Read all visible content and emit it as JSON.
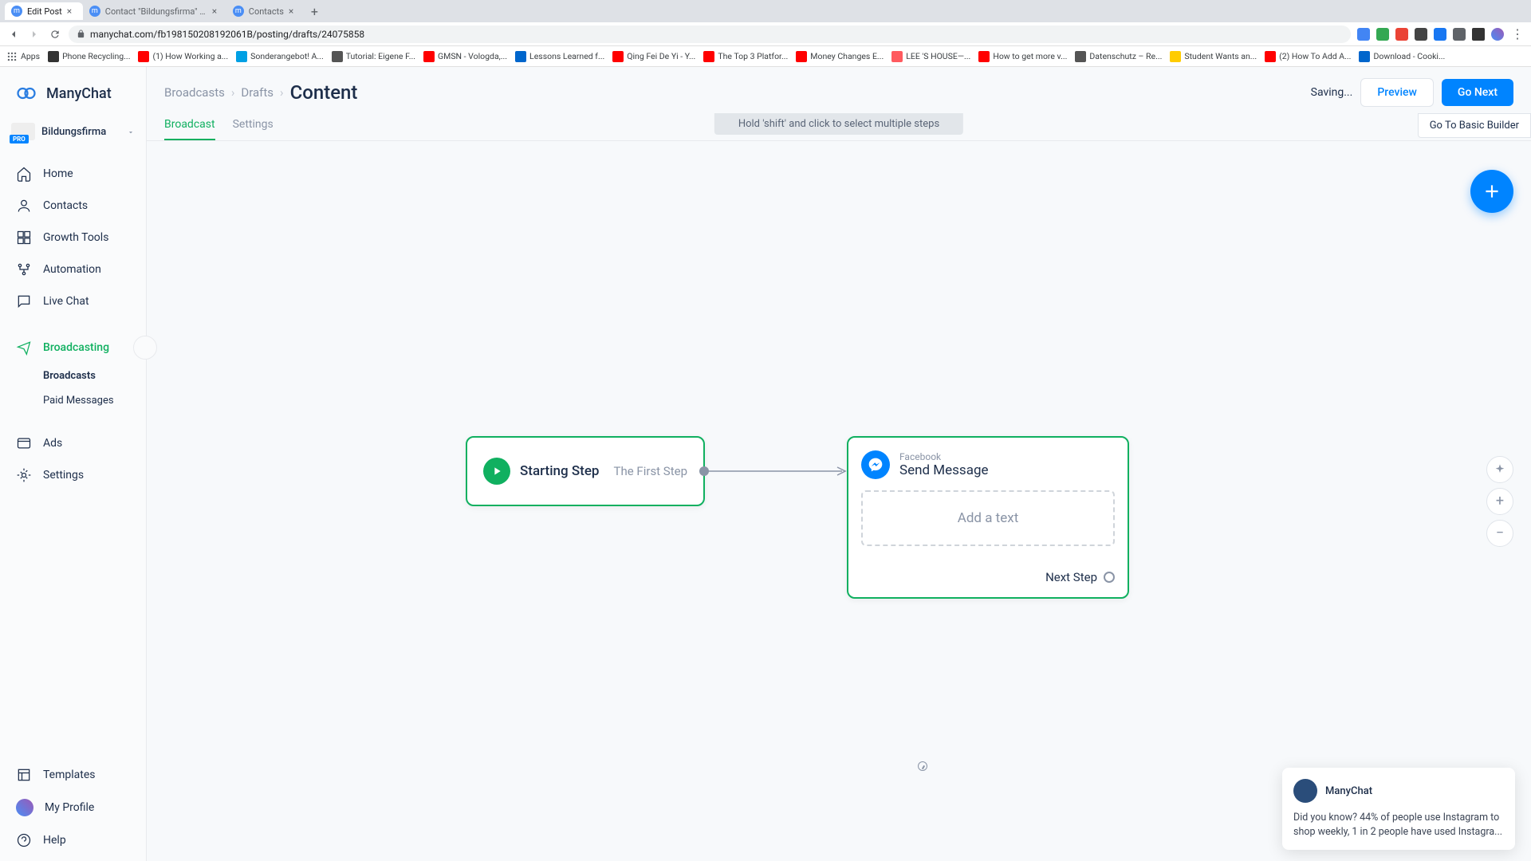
{
  "browser": {
    "tabs": [
      {
        "title": "Edit Post",
        "active": true
      },
      {
        "title": "Contact \"Bildungsfirma\" throu...",
        "active": false
      },
      {
        "title": "Contacts",
        "active": false
      }
    ],
    "url": "manychat.com/fb198150208192061B/posting/drafts/24075858",
    "bookmarks": [
      {
        "label": "Apps",
        "color": "#5f6368"
      },
      {
        "label": "Phone Recycling...",
        "color": "#333"
      },
      {
        "label": "(1) How Working a...",
        "color": "#ff0000"
      },
      {
        "label": "Sonderangebot! A...",
        "color": "#00a0e4"
      },
      {
        "label": "Tutorial: Eigene F...",
        "color": "#555"
      },
      {
        "label": "GMSN - Vologda,...",
        "color": "#ff0000"
      },
      {
        "label": "Lessons Learned f...",
        "color": "#0066cc"
      },
      {
        "label": "Qing Fei De Yi - Y...",
        "color": "#ff0000"
      },
      {
        "label": "The Top 3 Platfor...",
        "color": "#ff0000"
      },
      {
        "label": "Money Changes E...",
        "color": "#ff0000"
      },
      {
        "label": "LEE 'S HOUSE—...",
        "color": "#ff5a5f"
      },
      {
        "label": "How to get more v...",
        "color": "#ff0000"
      },
      {
        "label": "Datenschutz – Re...",
        "color": "#555"
      },
      {
        "label": "Student Wants an...",
        "color": "#ffcc00"
      },
      {
        "label": "(2) How To Add A...",
        "color": "#ff0000"
      },
      {
        "label": "Download - Cooki...",
        "color": "#0066cc"
      }
    ]
  },
  "sidebar": {
    "logo": "ManyChat",
    "workspace": {
      "name": "Bildungsfirma",
      "badge": "PRO"
    },
    "nav": [
      {
        "label": "Home",
        "icon": "home"
      },
      {
        "label": "Contacts",
        "icon": "user"
      },
      {
        "label": "Growth Tools",
        "icon": "grid"
      },
      {
        "label": "Automation",
        "icon": "flow"
      },
      {
        "label": "Live Chat",
        "icon": "chat"
      },
      {
        "label": "Broadcasting",
        "icon": "broadcast",
        "active": true
      },
      {
        "label": "Ads",
        "icon": "ads"
      },
      {
        "label": "Settings",
        "icon": "gear"
      }
    ],
    "sub_nav": [
      {
        "label": "Broadcasts",
        "bold": true
      },
      {
        "label": "Paid Messages",
        "bold": false
      }
    ],
    "bottom_nav": [
      {
        "label": "Templates",
        "icon": "template"
      },
      {
        "label": "My Profile",
        "icon": "avatar"
      },
      {
        "label": "Help",
        "icon": "help"
      }
    ]
  },
  "header": {
    "breadcrumb": [
      "Broadcasts",
      "Drafts",
      "Content"
    ],
    "status": "Saving...",
    "preview_btn": "Preview",
    "next_btn": "Go Next",
    "tabs": [
      {
        "label": "Broadcast",
        "active": true
      },
      {
        "label": "Settings",
        "active": false
      }
    ],
    "hint": "Hold 'shift' and click to select multiple steps",
    "basic_builder": "Go To Basic Builder"
  },
  "flow": {
    "start_node": {
      "title": "Starting Step",
      "label": "The First Step"
    },
    "msg_node": {
      "sub": "Facebook",
      "title": "Send Message",
      "placeholder": "Add a text",
      "next": "Next Step"
    }
  },
  "chat": {
    "name": "ManyChat",
    "body": "Did you know? 44% of people use Instagram to shop weekly, 1 in 2 people have used Instagra..."
  }
}
